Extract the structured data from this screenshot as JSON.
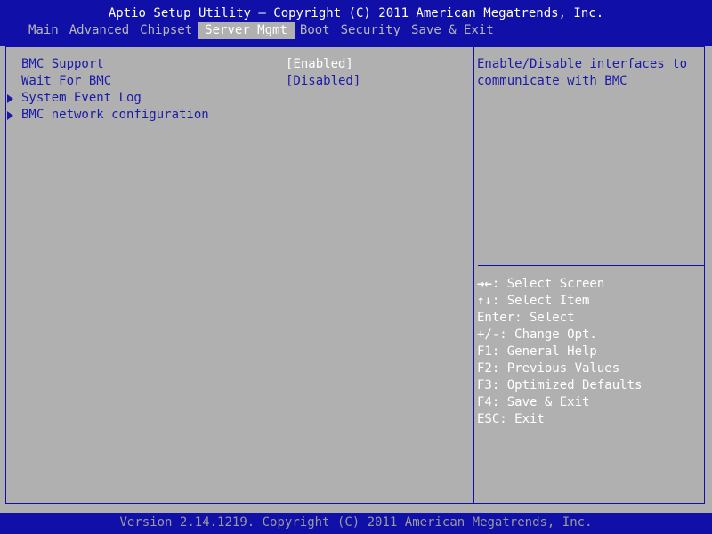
{
  "header": {
    "title": "Aptio Setup Utility – Copyright (C) 2011 American Megatrends, Inc."
  },
  "tabs": [
    {
      "label": "Main",
      "active": false
    },
    {
      "label": "Advanced",
      "active": false
    },
    {
      "label": "Chipset",
      "active": false
    },
    {
      "label": "Server Mgmt",
      "active": true
    },
    {
      "label": "Boot",
      "active": false
    },
    {
      "label": "Security",
      "active": false
    },
    {
      "label": "Save & Exit",
      "active": false
    }
  ],
  "settings": [
    {
      "label": "BMC Support",
      "value": "[Enabled]"
    },
    {
      "label": "Wait For BMC",
      "value": "[Disabled]"
    }
  ],
  "submenus": [
    {
      "label": "System Event Log"
    },
    {
      "label": "BMC network configuration"
    }
  ],
  "help": {
    "line1": "Enable/Disable interfaces to",
    "line2": "communicate with BMC"
  },
  "keys": [
    {
      "glyph": "→←",
      "text": ": Select Screen"
    },
    {
      "glyph": "↑↓",
      "text": ": Select Item"
    },
    {
      "glyph": "",
      "text": "Enter: Select"
    },
    {
      "glyph": "",
      "text": "+/-: Change Opt."
    },
    {
      "glyph": "",
      "text": "F1: General Help"
    },
    {
      "glyph": "",
      "text": "F2: Previous Values"
    },
    {
      "glyph": "",
      "text": "F3: Optimized Defaults"
    },
    {
      "glyph": "",
      "text": "F4: Save & Exit"
    },
    {
      "glyph": "",
      "text": "ESC: Exit"
    }
  ],
  "footer": {
    "version": "Version 2.14.1219. Copyright (C) 2011 American Megatrends, Inc."
  },
  "colors": {
    "frame_blue": "#1010a8",
    "background_gray": "#b0b0b0",
    "label_blue": "#1a1aa8",
    "value_white": "#ffffff"
  }
}
